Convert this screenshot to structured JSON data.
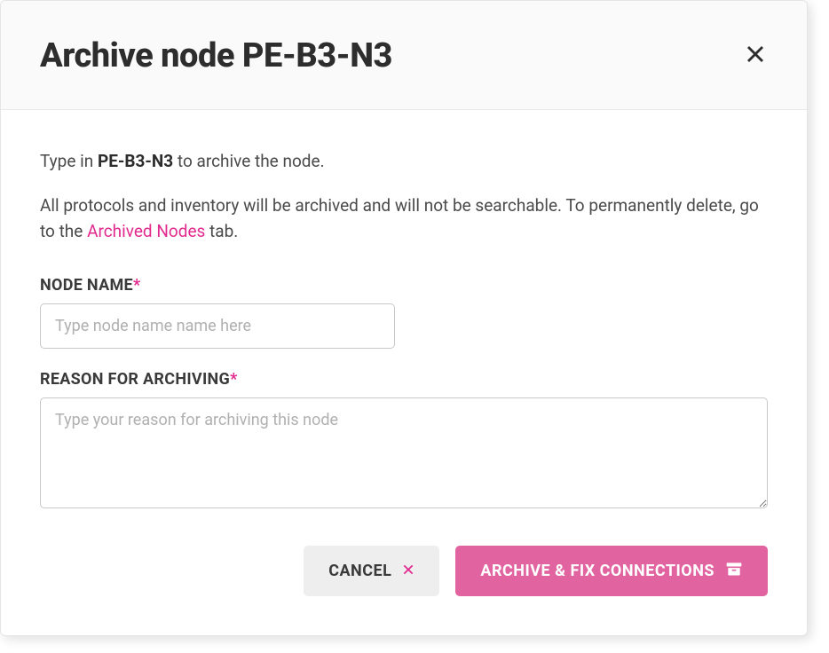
{
  "modal": {
    "title": "Archive node PE-B3-N3",
    "instruction_prefix": "Type in ",
    "instruction_node": "PE-B3-N3",
    "instruction_suffix": " to archive the node.",
    "description_prefix": "All protocols and inventory will be archived and will not be searchable. To permanently delete, go to the ",
    "description_link": "Archived Nodes",
    "description_suffix": " tab."
  },
  "form": {
    "node_name": {
      "label": "NODE NAME",
      "placeholder": "Type node name name here",
      "value": ""
    },
    "reason": {
      "label": "REASON FOR ARCHIVING",
      "placeholder": "Type your reason for archiving this node",
      "value": ""
    }
  },
  "buttons": {
    "cancel": "CANCEL",
    "archive": "ARCHIVE & FIX CONNECTIONS"
  }
}
